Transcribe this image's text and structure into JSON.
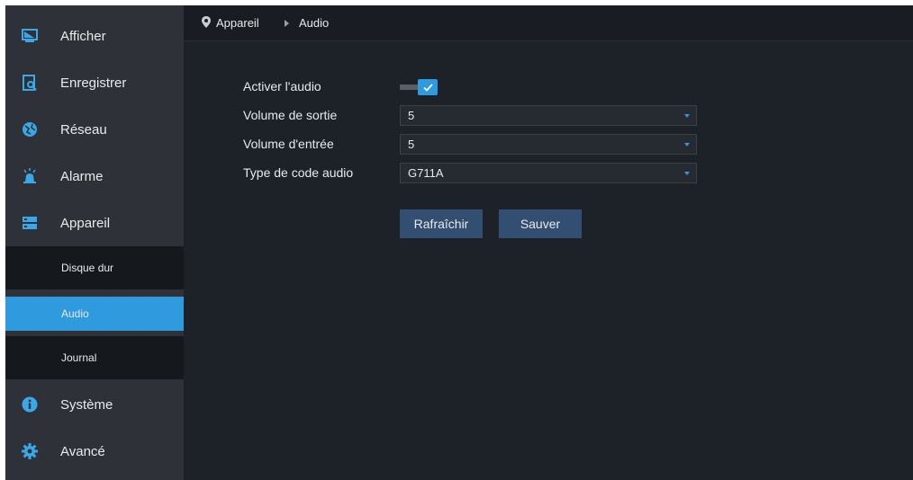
{
  "sidebar": {
    "items": [
      {
        "label": "Afficher",
        "icon": "monitor-icon"
      },
      {
        "label": "Enregistrer",
        "icon": "record-search-icon"
      },
      {
        "label": "Réseau",
        "icon": "network-globe-icon"
      },
      {
        "label": "Alarme",
        "icon": "alarm-siren-icon"
      },
      {
        "label": "Appareil",
        "icon": "device-storage-icon"
      }
    ],
    "subitems": [
      {
        "label": "Disque dur"
      },
      {
        "label": "Audio"
      },
      {
        "label": "Journal"
      }
    ],
    "bottom_items": [
      {
        "label": "Système",
        "icon": "info-icon"
      },
      {
        "label": "Avancé",
        "icon": "gear-icon"
      }
    ],
    "active_subitem": "Audio"
  },
  "breadcrumb": {
    "icon": "location-pin-icon",
    "parent": "Appareil",
    "current": "Audio"
  },
  "form": {
    "enable_audio_label": "Activer l'audio",
    "enable_audio_checked": true,
    "output_volume_label": "Volume de sortie",
    "output_volume_value": "5",
    "input_volume_label": "Volume d'entrée",
    "input_volume_value": "5",
    "codec_label": "Type de code audio",
    "codec_value": "G711A"
  },
  "buttons": {
    "refresh_label": "Rafraîchir",
    "save_label": "Sauver"
  },
  "colors": {
    "accent": "#2f9bde",
    "button": "#324e70",
    "sidebar_bg": "#2e3238",
    "main_bg": "#1d2128"
  }
}
